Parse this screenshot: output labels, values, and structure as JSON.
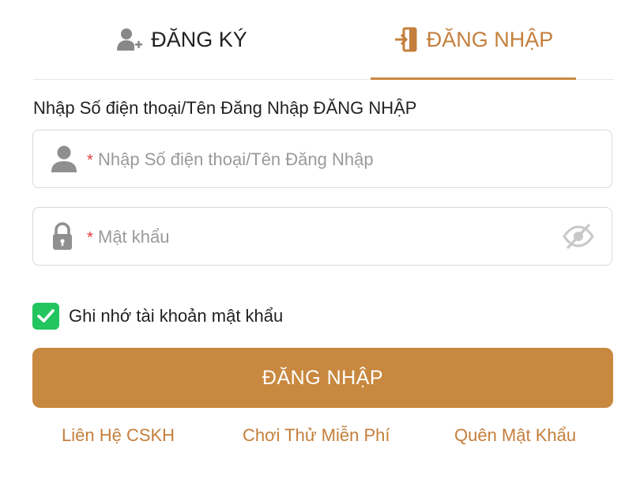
{
  "tabs": {
    "register": {
      "label": "ĐĂNG KÝ",
      "icon": "user-add-icon"
    },
    "login": {
      "label": "ĐĂNG NHẬP",
      "icon": "login-door-icon",
      "active": true
    }
  },
  "form": {
    "username_label": "Nhập Số điện thoại/Tên Đăng Nhập ĐĂNG NHẬP",
    "username": {
      "required_mark": "*",
      "placeholder": "Nhập Số điện thoại/Tên Đăng Nhập",
      "value": "",
      "icon": "user-icon"
    },
    "password": {
      "required_mark": "*",
      "placeholder": "Mật khẩu",
      "value": "",
      "icon": "lock-icon",
      "toggle_icon": "eye-off-icon"
    },
    "remember": {
      "label": "Ghi nhớ tài khoản mật khẩu",
      "checked": true
    },
    "submit_label": "ĐĂNG NHẬP"
  },
  "links": {
    "support": "Liên Hệ CSKH",
    "free_trial": "Chơi Thử Miễn Phí",
    "forgot_password": "Quên Mật Khẩu"
  },
  "colors": {
    "accent": "#c9883f",
    "check": "#22c55e",
    "required": "#e23b3b"
  }
}
